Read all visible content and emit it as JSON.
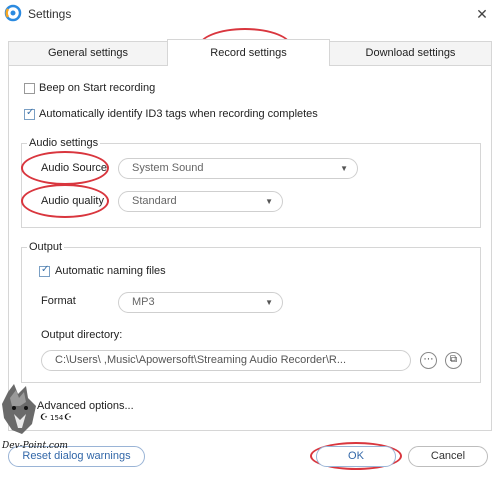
{
  "window": {
    "title": "Settings",
    "close_symbol": "✕"
  },
  "tabs": [
    {
      "label": "General settings",
      "active": false
    },
    {
      "label": "Record settings",
      "active": true
    },
    {
      "label": "Download settings",
      "active": false
    }
  ],
  "options": {
    "beep_on_start": {
      "label": "Beep on Start recording",
      "checked": false
    },
    "auto_id3": {
      "label": "Automatically identify ID3 tags when recording completes",
      "checked": true
    }
  },
  "audio_settings": {
    "title": "Audio settings",
    "source_label": "Audio Source",
    "source_value": "System Sound",
    "quality_label": "Audio quality",
    "quality_value": "Standard"
  },
  "output": {
    "title": "Output",
    "auto_naming": {
      "label": "Automatic naming files",
      "checked": true
    },
    "format_label": "Format",
    "format_value": "MP3",
    "directory_label": "Output directory:",
    "directory_value": "C:\\Users\\              ,Music\\Apowersoft\\Streaming Audio Recorder\\R...",
    "more_symbol": "⋯",
    "folder_symbol": "⧉"
  },
  "advanced_options_label": "Advanced options...",
  "watermark": {
    "text": "Dev-Point.com",
    "badge": "154"
  },
  "footer": {
    "reset_label": "Reset dialog warnings",
    "ok_label": "OK",
    "cancel_label": "Cancel"
  },
  "colors": {
    "accent": "#3267a8",
    "highlight": "#d9363e",
    "border": "#d6d6d6"
  }
}
